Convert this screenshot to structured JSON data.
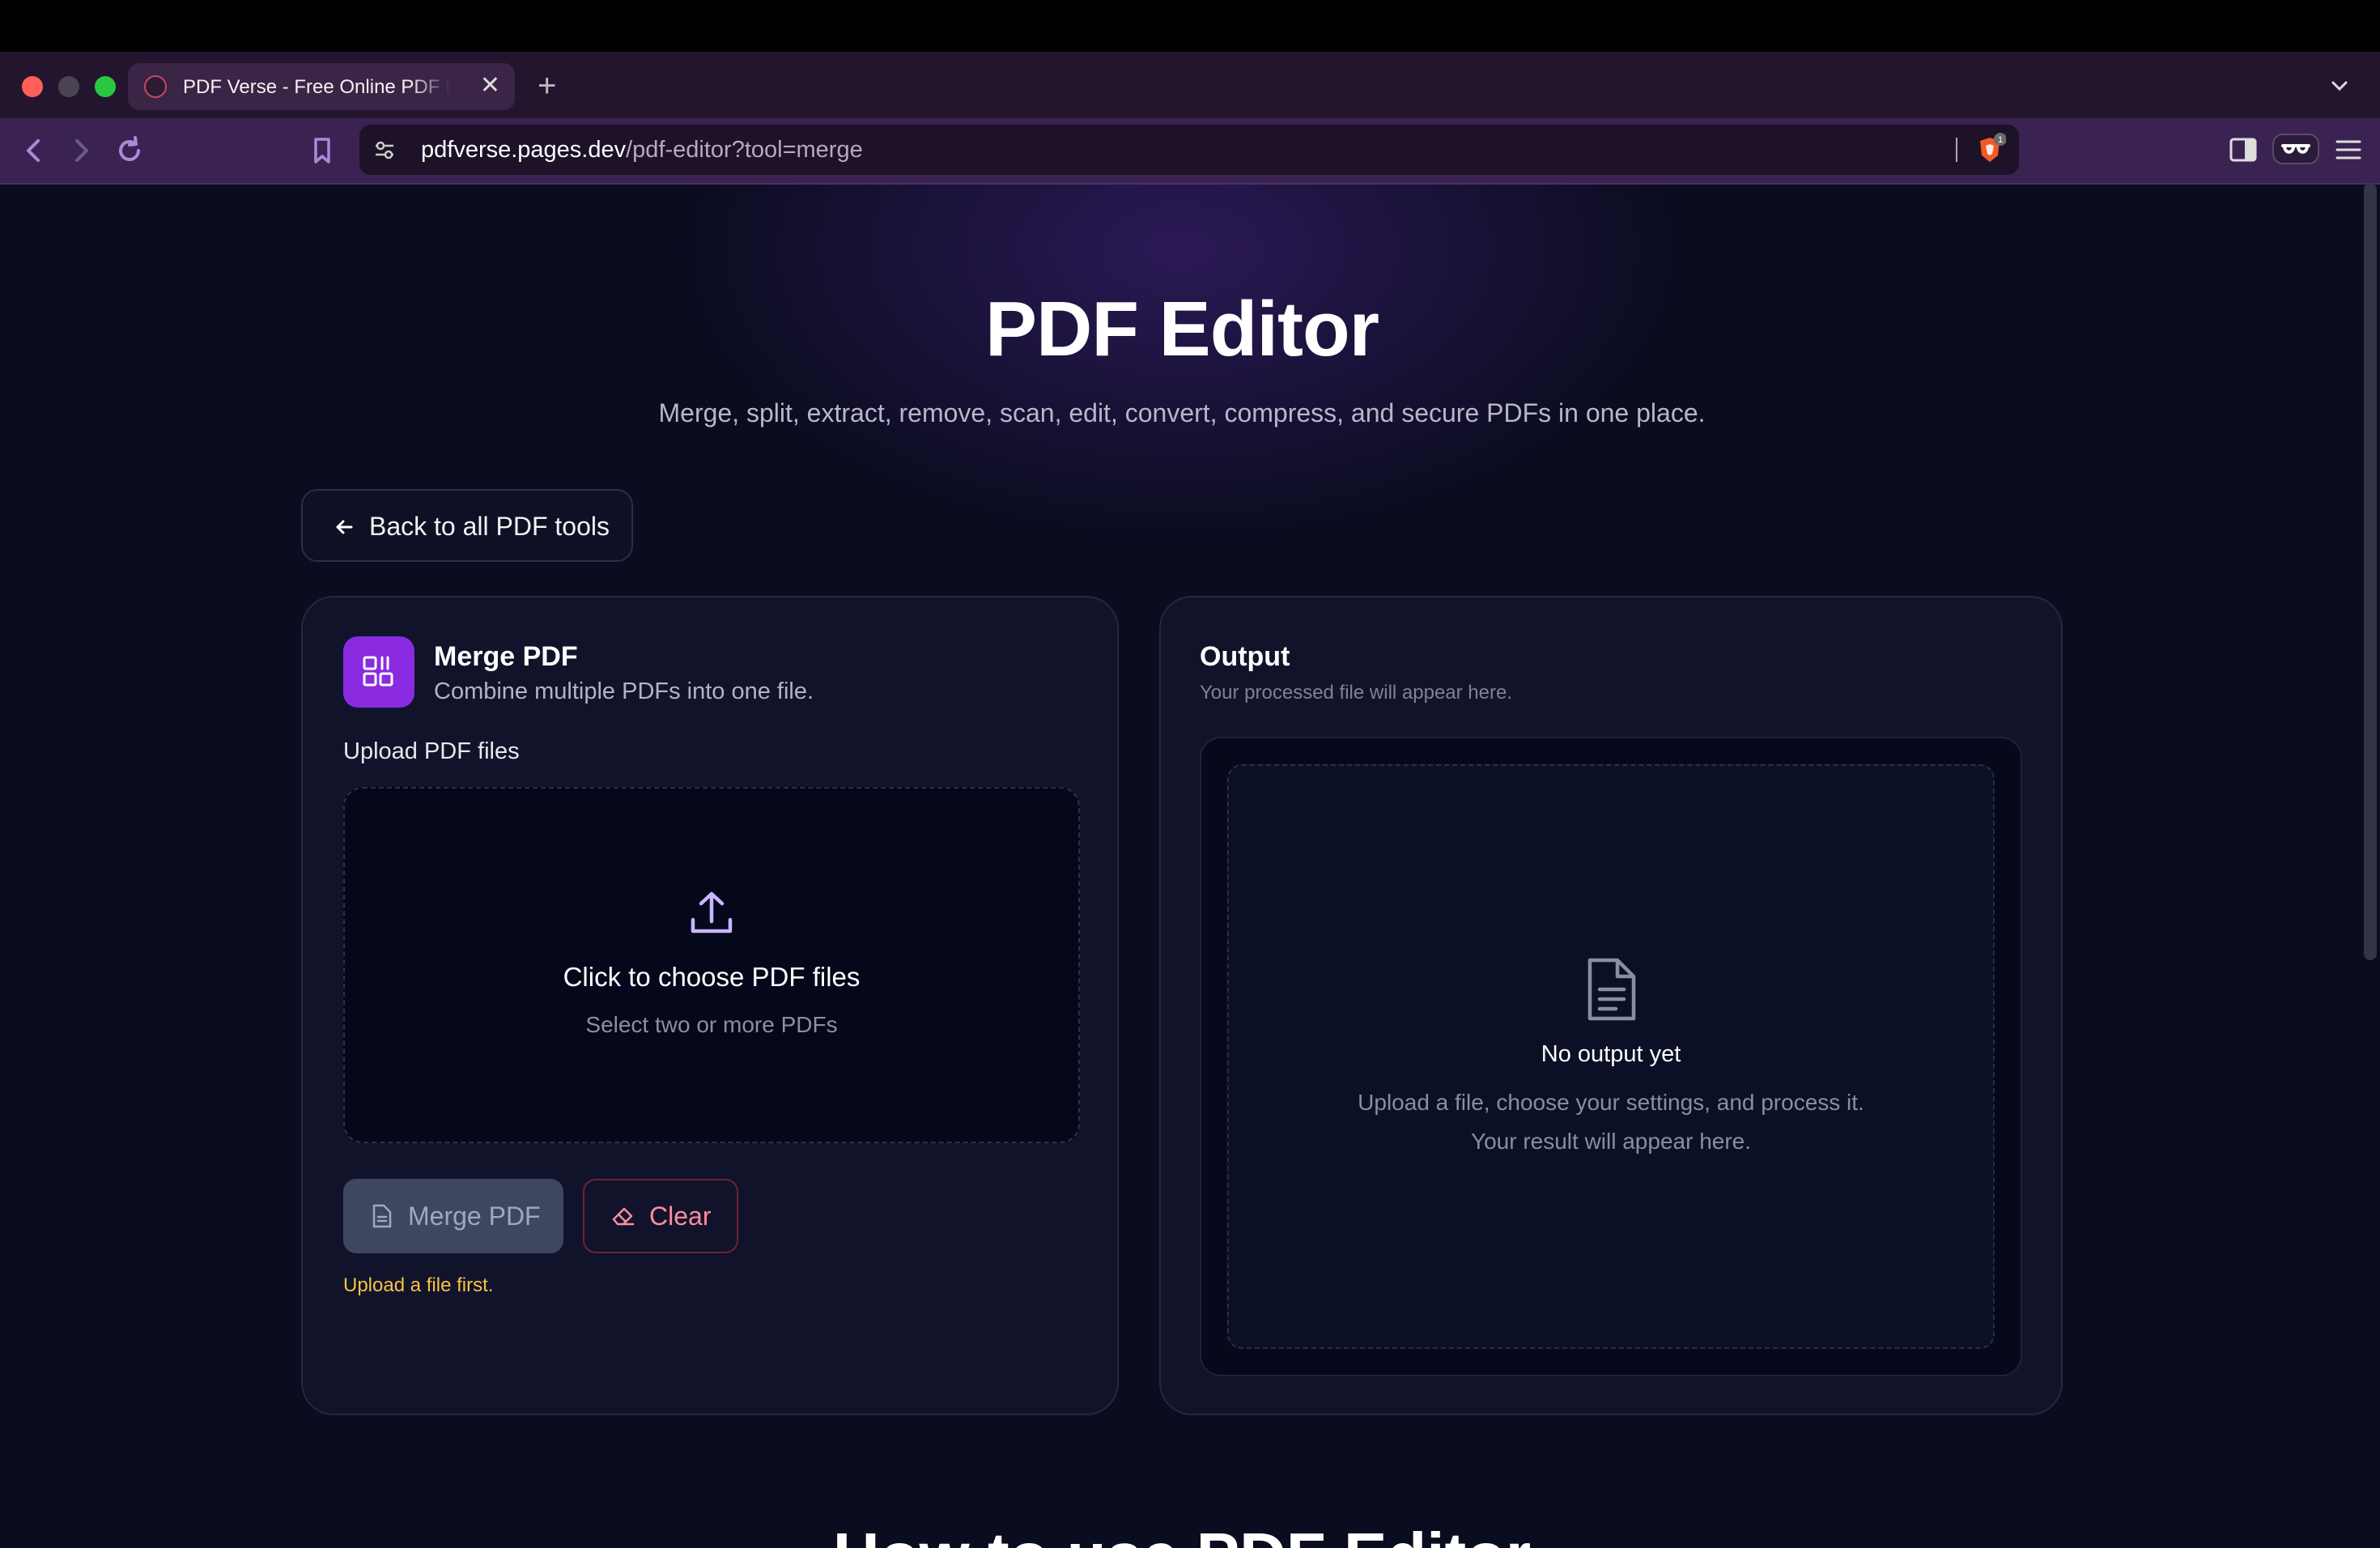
{
  "browser": {
    "tab_title": "PDF Verse - Free Online PDF Editor",
    "url_host": "pdfverse.pages.dev",
    "url_path": "/pdf-editor?tool=merge",
    "shield_count": "1"
  },
  "hero": {
    "title": "PDF Editor",
    "subtitle": "Merge, split, extract, remove, scan, edit, convert, compress, and secure PDFs in one place."
  },
  "back_button": "Back to all PDF tools",
  "tool": {
    "title": "Merge PDF",
    "description": "Combine multiple PDFs into one file.",
    "upload_label": "Upload PDF files",
    "dropzone_title": "Click to choose PDF files",
    "dropzone_sub": "Select two or more PDFs",
    "merge_label": "Merge PDF",
    "clear_label": "Clear",
    "warning": "Upload a file first."
  },
  "output": {
    "title": "Output",
    "description": "Your processed file will appear here.",
    "empty_title": "No output yet",
    "empty_desc": "Upload a file, choose your settings, and process it. Your result will appear here."
  },
  "next_section_title": "How to use PDF Editor",
  "colors": {
    "accent": "#8a2be2",
    "warning": "#f5c343",
    "clear": "#ff8ca0"
  }
}
